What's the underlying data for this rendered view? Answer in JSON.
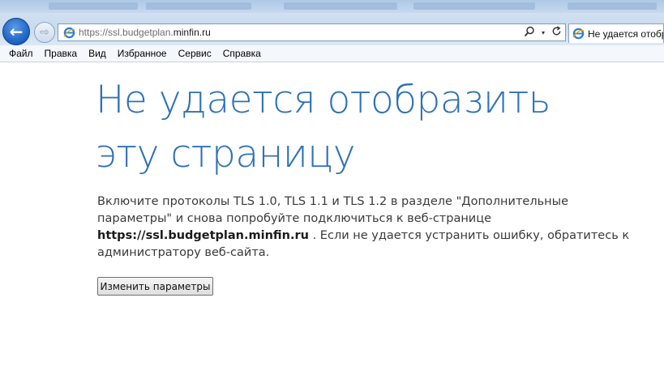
{
  "browser": {
    "url_prefix": "https://ssl.budgetplan.",
    "url_host": "minfin.ru",
    "tab_title": "Не удается отобр",
    "nav_back_icon": "back-arrow-icon",
    "nav_forward_icon": "forward-arrow-icon",
    "search_icon": "search-icon",
    "refresh_icon": "refresh-icon",
    "favicon": "ie-logo-icon"
  },
  "menubar": {
    "items": [
      "Файл",
      "Правка",
      "Вид",
      "Избранное",
      "Сервис",
      "Справка"
    ]
  },
  "error": {
    "title": "Не удается отобразить эту страницу",
    "body_part1": "Включите протоколы TLS 1.0, TLS 1.1 и TLS 1.2 в разделе \"Дополнительные параметры\" и снова попробуйте подключиться к веб-странице ",
    "body_url": "https://ssl.budgetplan.minfin.ru",
    "body_part2": " . Если не удается устранить ошибку, обратитесь к администратору веб-сайта.",
    "button_label": "Изменить параметры"
  },
  "colors": {
    "title_blue": "#2e71b8",
    "nav_blue": "#1a5fc2"
  }
}
